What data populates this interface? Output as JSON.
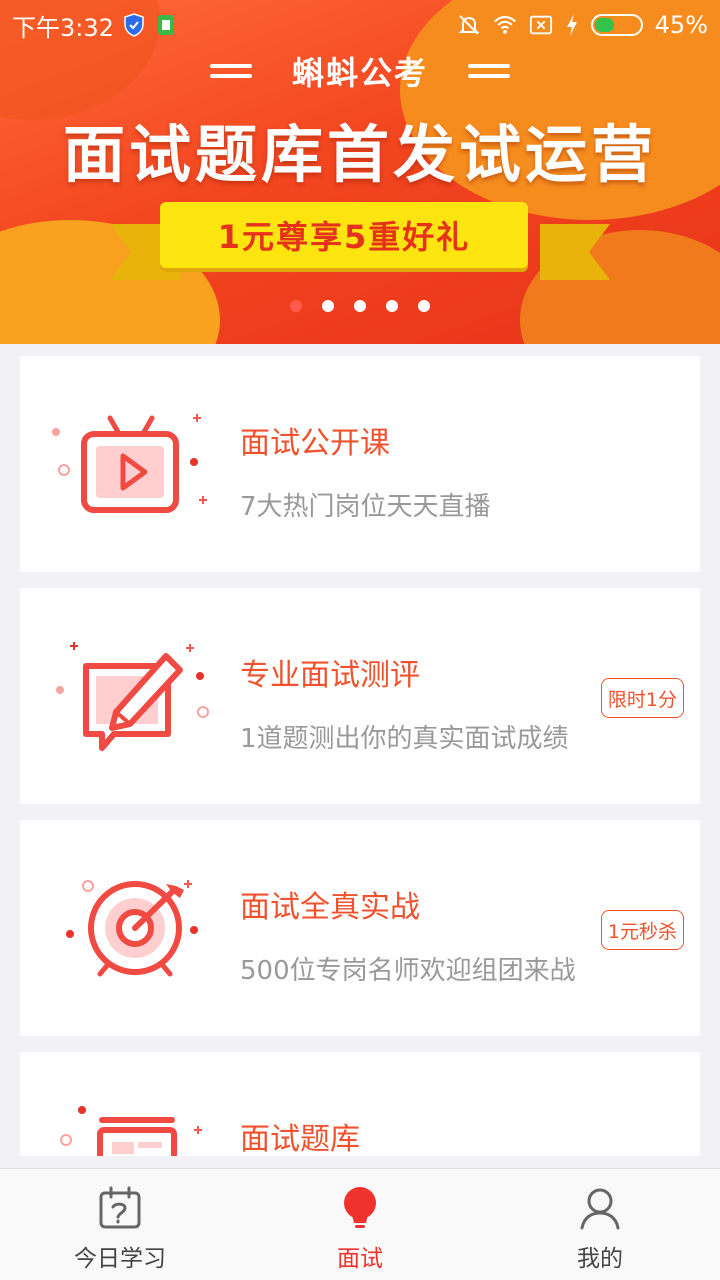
{
  "status_bar": {
    "time": "下午3:32",
    "battery_percent": "45%",
    "battery_level": 0.45,
    "icons": [
      "shield-icon",
      "battery-saver-icon",
      "mute-bell-icon",
      "wifi-icon",
      "no-sim-icon",
      "charging-icon",
      "battery-icon"
    ]
  },
  "banner": {
    "brand": "蝌蚪公考",
    "title": "面试题库首发试运营",
    "ribbon": "1元尊享5重好礼",
    "slide_count": 5,
    "active_slide": 1
  },
  "cards": [
    {
      "title": "面试公开课",
      "subtitle": "7大热门岗位天天直播",
      "icon": "tv-play-icon",
      "badge": ""
    },
    {
      "title": "专业面试测评",
      "subtitle": "1道题测出你的真实面试成绩",
      "icon": "pencil-board-icon",
      "badge": "限时1分"
    },
    {
      "title": "面试全真实战",
      "subtitle": "500位专岗名师欢迎组团来战",
      "icon": "target-arrow-icon",
      "badge": "1元秒杀"
    },
    {
      "title": "面试题库",
      "subtitle": "",
      "icon": "question-bank-icon",
      "badge": ""
    }
  ],
  "tabbar": {
    "tabs": [
      {
        "label": "今日学习",
        "icon": "calendar-icon",
        "active": false
      },
      {
        "label": "面试",
        "icon": "bulb-icon",
        "active": true
      },
      {
        "label": "我的",
        "icon": "user-icon",
        "active": false
      }
    ]
  },
  "colors": {
    "accent": "#f0522e",
    "tab_active": "#f0322e",
    "banner_red": "#e8331a",
    "banner_orange": "#f68c1e",
    "ribbon_yellow": "#ffe510"
  }
}
